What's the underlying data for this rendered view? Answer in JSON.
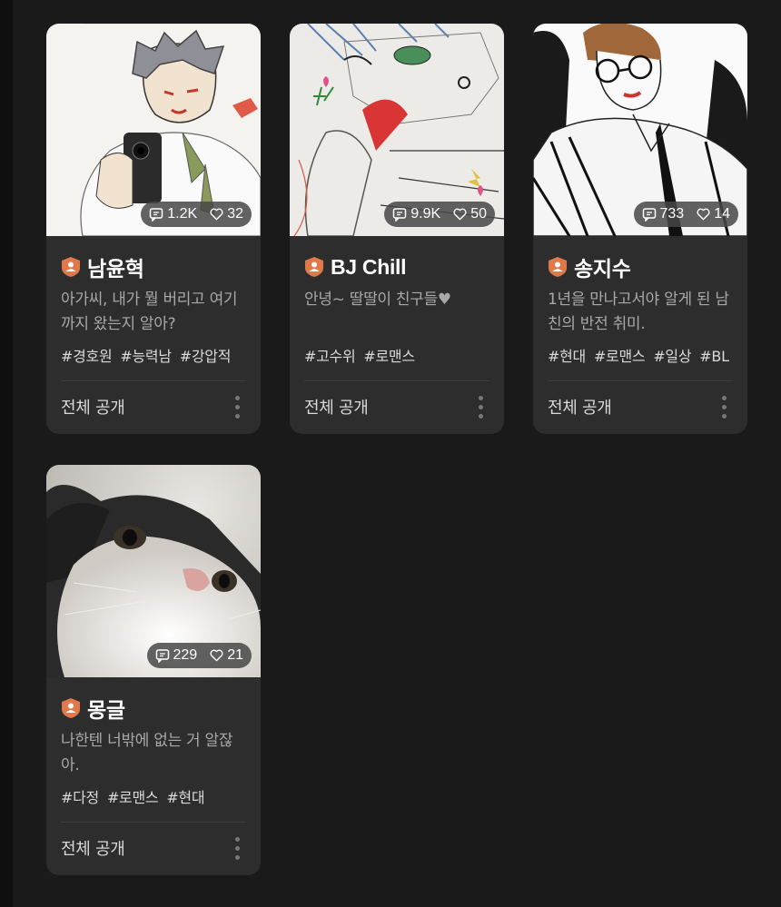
{
  "colors": {
    "background": "#1a1a1a",
    "card": "#2d2d2d",
    "badge": "#e0784a",
    "title": "#ffffff",
    "description": "#a8a8a8",
    "tag": "#d9d9d9"
  },
  "cards": [
    {
      "title": "남윤혁",
      "description": "아가씨, 내가 뭘 버리고 여기까지 왔는지 알아?",
      "tags": [
        "#경호원",
        "#능력남",
        "#강압적"
      ],
      "comments": "1.2K",
      "likes": "32",
      "visibility": "전체 공개",
      "badge_icon": "creator-badge-icon",
      "image": "drawing-man-with-gun"
    },
    {
      "title": "BJ Chill",
      "description": "안녕~ 딸딸이 친구들♥",
      "tags": [
        "#고수위",
        "#로맨스"
      ],
      "comments": "9.9K",
      "likes": "50",
      "visibility": "전체 공개",
      "badge_icon": "creator-badge-icon",
      "image": "colored-pencil-sketch"
    },
    {
      "title": "송지수",
      "description": "1년을 만나고서야 알게 된 남친의 반전 취미.",
      "tags": [
        "#현대",
        "#로맨스",
        "#일상",
        "#BL"
      ],
      "comments": "733",
      "likes": "14",
      "visibility": "전체 공개",
      "badge_icon": "creator-badge-icon",
      "image": "ink-drawing-man-with-glasses"
    },
    {
      "title": "몽글",
      "description": "나한텐 너밖에 없는 거 알잖아.",
      "tags": [
        "#다정",
        "#로맨스",
        "#현대"
      ],
      "comments": "229",
      "likes": "21",
      "visibility": "전체 공개",
      "badge_icon": "creator-badge-icon",
      "image": "cat-photo"
    }
  ]
}
